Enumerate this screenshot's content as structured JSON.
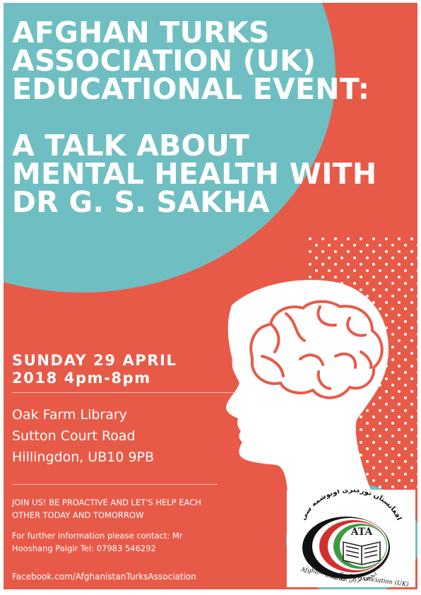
{
  "headline": {
    "line1": "AFGHAN TURKS",
    "line2": "ASSOCIATION (UK)",
    "line3": "EDUCATIONAL EVENT:",
    "line4": "A TALK ABOUT",
    "line5": "MENTAL HEALTH WITH",
    "line6": "DR G. S. SAKHA"
  },
  "event_date": {
    "line1": "SUNDAY 29 APRIL",
    "line2": "2018 4pm-8pm"
  },
  "venue": {
    "line1": "Oak Farm Library",
    "line2": "Sutton Court Road",
    "line3": "Hillingdon, UB10 9PB"
  },
  "join": {
    "line1": "JOIN US! BE PROACTIVE AND LET'S HELP EACH",
    "line2": "OTHER TODAY AND TOMORROW"
  },
  "contact": {
    "line1": "For further information please contact:  Mr",
    "line2": "Hooshang Paigir Tel: 07983 546292"
  },
  "facebook": "Facebook.com/AfghanistanTurksAssociation",
  "logo": {
    "abbr": "ATA",
    "arabic_top": "افغانستان تورکلری اویوشمه سی",
    "arabic_bottom": "انجمن ترکان افغانستان",
    "english": "Afghanistan Turks Association (UK)"
  },
  "colors": {
    "coral": "#e85a48",
    "teal": "#6fbfc2",
    "white": "#ffffff"
  },
  "icons": [
    "head-profile-icon",
    "brain-icon",
    "open-book-icon"
  ]
}
